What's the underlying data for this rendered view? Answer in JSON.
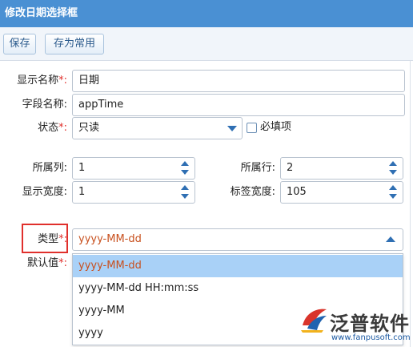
{
  "window": {
    "title": "修改日期选择框"
  },
  "toolbar": {
    "save_label": "保存",
    "save_common_label": "存为常用"
  },
  "form": {
    "display_name": {
      "label": "显示名称",
      "required_mark": "*:",
      "value": "日期"
    },
    "field_name": {
      "label": "字段名称:",
      "value": "appTime"
    },
    "status": {
      "label": "状态",
      "required_mark": "*:",
      "value": "只读"
    },
    "required_checkbox": {
      "label": "必填项",
      "checked": false
    },
    "column": {
      "label": "所属列:",
      "value": "1"
    },
    "row": {
      "label": "所属行:",
      "value": "2"
    },
    "display_width": {
      "label": "显示宽度:",
      "value": "1"
    },
    "label_width": {
      "label": "标签宽度:",
      "value": "105"
    },
    "type": {
      "label": "类型",
      "required_mark": "*:",
      "value": "yyyy-MM-dd"
    },
    "default_value": {
      "label": "默认值",
      "required_mark": "*:"
    }
  },
  "type_dropdown": {
    "options": [
      "yyyy-MM-dd",
      "yyyy-MM-dd HH:mm:ss",
      "yyyy-MM",
      "yyyy"
    ],
    "selected_index": 0
  },
  "logo": {
    "name": "泛普软件",
    "url": "www.fanpusoft.com",
    "icon": "fanpu-logo-icon"
  },
  "colors": {
    "title_bar": "#4a90d3",
    "highlight_red": "#e0302c",
    "selected_option": "#a9d1f7",
    "selected_text": "#c8501e",
    "accent_blue": "#2f6fb3"
  }
}
